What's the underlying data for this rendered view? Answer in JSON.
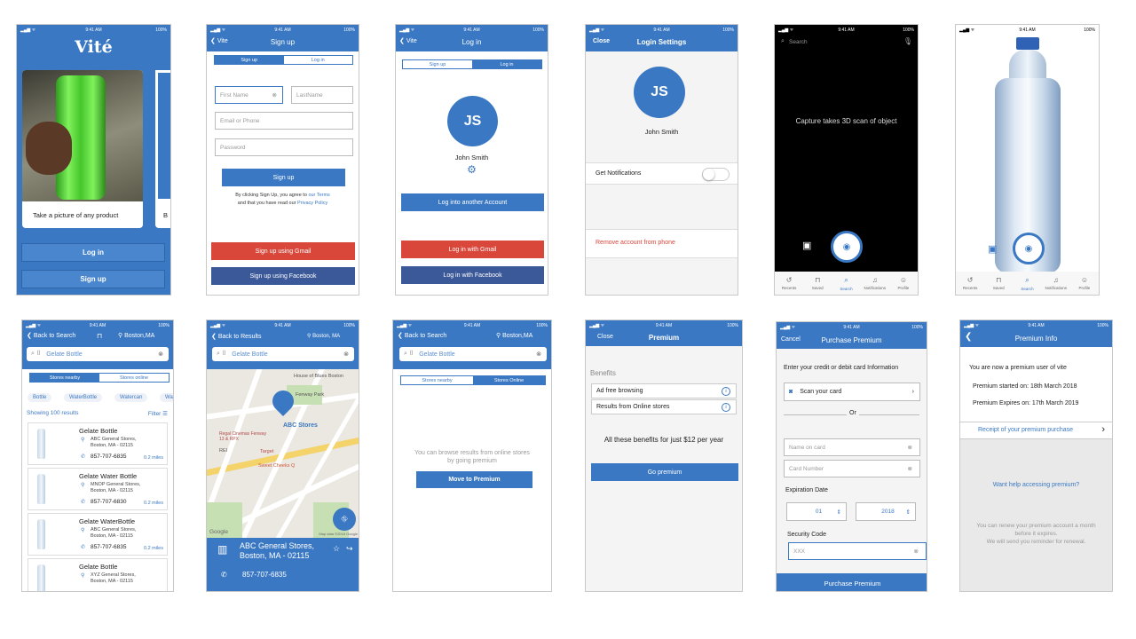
{
  "status": {
    "time": "9:41 AM",
    "battery": "100%"
  },
  "colors": {
    "primary": "#3a78c3",
    "gmail": "#d9473a",
    "facebook": "#3b5998"
  },
  "splash": {
    "brand": "Vité",
    "card_caption": "Take a picture of any product",
    "next_card_caption": "B",
    "login": "Log in",
    "signup": "Sign up"
  },
  "signup": {
    "back": "Vite",
    "title": "Sign up",
    "seg_signup": "Sign up",
    "seg_login": "Log in",
    "first_name": "First Name",
    "last_name": "LastName",
    "email_phone": "Email or Phone",
    "password": "Password",
    "button": "Sign up",
    "terms_1": "By clicking Sign Up, you agree to",
    "terms_link": "our Terms",
    "terms_2": "and that you have read our",
    "privacy_link": "Privacy Policy",
    "gmail": "Sign up using Gmail",
    "facebook": "Sign up using Facebook"
  },
  "login": {
    "back": "Vite",
    "title": "Log in",
    "seg_signup": "Sign up",
    "seg_login": "Log in",
    "initials": "JS",
    "name": "John Smith",
    "another": "Log into another Account",
    "gmail": "Log in with Gmail",
    "facebook": "Log in with Facebook"
  },
  "settings": {
    "close": "Close",
    "title": "Login Settings",
    "initials": "JS",
    "name": "John Smith",
    "notifications": "Get Notifications",
    "remove": "Remove account from phone"
  },
  "camera": {
    "placeholder": "Search",
    "message": "Capture takes 3D scan of object"
  },
  "tabbar": {
    "items": [
      "Recents",
      "Saved",
      "Search",
      "Notifications",
      "Profile"
    ]
  },
  "results": {
    "back": "Back to Search",
    "location": "Boston,MA",
    "query": "Gelate Bottle",
    "seg_nearby": "Stores nearby",
    "seg_online": "Stores online",
    "chips": [
      "Bottle",
      "WaterBottle",
      "Watercan",
      "Wa"
    ],
    "showing": "Showing 100 results",
    "filter": "Filter",
    "items": [
      {
        "name": "Gelate Bottle",
        "addr1": "ABC General Stores,",
        "addr2": "Boston, MA - 02115",
        "phone": "857-707-6835",
        "dist": "0.2 miles"
      },
      {
        "name": "Gelate Water Bottle",
        "addr1": "MNOP  General Stores,",
        "addr2": "Boston, MA - 02115",
        "phone": "857-707-6830",
        "dist": "0.2 miles"
      },
      {
        "name": "Gelate WaterBottle",
        "addr1": "ABC General Stores,",
        "addr2": "Boston, MA - 02115",
        "phone": "857-707-6835",
        "dist": "0.2 miles"
      },
      {
        "name": "Gelate Bottle",
        "addr1": "XYZ General Stores,",
        "addr2": "Boston, MA - 02115",
        "phone": "",
        "dist": ""
      }
    ]
  },
  "map": {
    "back": "Back to Results",
    "location": "Boston, MA",
    "query": "Gelate Bottle",
    "pin_label": "ABC Stores",
    "labels": {
      "hob": "House of Blues Boston",
      "park": "Fenway Park",
      "regal": "Regal Cinemas Fenway 13 & RPX",
      "target": "Target",
      "sweet": "Sweet Cheeks Q",
      "rei": "REI",
      "google": "Google",
      "copyright": "Map data ©2018 Google"
    },
    "store_name": "ABC General Stores,",
    "store_addr": "Boston, MA - 02115",
    "phone": "857-707-6835"
  },
  "online": {
    "back": "Back to Search",
    "location": "Boston,MA",
    "query": "Gelate Bottle",
    "seg_nearby": "Stores nearby",
    "seg_online": "Stores Online",
    "message_1": "You can browse results from online stores",
    "message_2": "by going premium",
    "button": "Move to Premium"
  },
  "premium": {
    "close": "Close",
    "title": "Premium",
    "benefits": "Benefits",
    "b1": "Ad free browsing",
    "b2": "Results from Online stores",
    "price": "All these benefits for just $12 per year",
    "button": "Go premium"
  },
  "purchase": {
    "cancel": "Cancel",
    "title": "Purchase Premium",
    "intro": "Enter your credit or debit  card Information",
    "scan": "Scan your card",
    "or": "Or",
    "name_ph": "Name on card",
    "number_ph": "Card Number",
    "exp_label": "Expiration Date",
    "month": "01",
    "year": "2018",
    "code_label": "Security Code",
    "code_ph": "XXX",
    "button": "Purchase Premium"
  },
  "info": {
    "title": "Premium Info",
    "line1": "You are now a premium user of vite",
    "line2": "Premium started on: 18th March 2018",
    "line3": "Premium Expires on: 17th March 2019",
    "receipt": "Receipt of your premium purchase",
    "help": "Want help accessing premium?",
    "renew_1": "You can renew your premium account a month",
    "renew_2": "before it expires.",
    "renew_3": "We will send you reminder for renewal."
  }
}
